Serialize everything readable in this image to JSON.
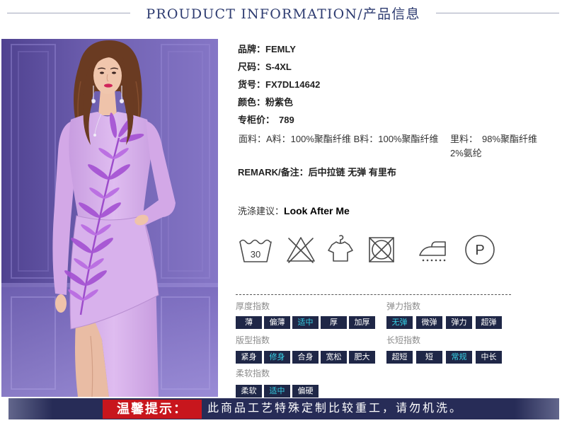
{
  "header": {
    "title": "PROUDUCT INFORMATION/产品信息"
  },
  "product": {
    "brand": {
      "label": "品牌：",
      "value": "FEMLY"
    },
    "size": {
      "label": "尺码：",
      "value": "S-4XL"
    },
    "item_no": {
      "label": "货号：",
      "value": "FX7DL14642"
    },
    "color": {
      "label": "颜色：",
      "value": "粉紫色"
    },
    "price": {
      "label": "专柜价：",
      "value": "789"
    },
    "fabric": {
      "label": "面料：",
      "parts": [
        "A料：100%聚酯纤维",
        "B料：100%聚酯纤维"
      ]
    },
    "lining": {
      "label": "里料：",
      "parts": [
        "98%聚酯纤维",
        "2%氨纶"
      ]
    },
    "remark": {
      "label": "REMARK/备注：",
      "value": "后中拉链 无弹 有里布"
    },
    "care": {
      "label": "洗涤建议：",
      "value": "Look After Me"
    }
  },
  "care_icons": [
    {
      "icon": "wash-30-icon",
      "text": "30"
    },
    {
      "icon": "no-bleach-icon"
    },
    {
      "icon": "hang-dry-icon"
    },
    {
      "icon": "no-tumble-dry-icon"
    },
    {
      "icon": "steam-iron-icon"
    },
    {
      "icon": "dry-clean-p-icon",
      "text": "P"
    }
  ],
  "indices": {
    "thickness": {
      "label": "厚度指数",
      "options": [
        "薄",
        "偏薄",
        "适中",
        "厚",
        "加厚"
      ],
      "selected": 2
    },
    "elasticity": {
      "label": "弹力指数",
      "options": [
        "无弹",
        "微弹",
        "弹力",
        "超弹"
      ],
      "selected": 0
    },
    "fit": {
      "label": "版型指数",
      "options": [
        "紧身",
        "修身",
        "合身",
        "宽松",
        "肥大"
      ],
      "selected": 1
    },
    "length": {
      "label": "长短指数",
      "options": [
        "超短",
        "短",
        "常规",
        "中长"
      ],
      "selected": 2
    },
    "softness": {
      "label": "柔软指数",
      "options": [
        "柔软",
        "适中",
        "偏硬"
      ],
      "selected": 1
    }
  },
  "notice": {
    "label": "温馨提示：",
    "text": "此商品工艺特殊定制比较重工，请勿机洗。"
  },
  "colors": {
    "header_text": "#2d3b70",
    "index_button_bg": "#1f2747",
    "selected_text": "#36cfe4",
    "notice_label_bg": "#c8161d",
    "banner_bg": "#272c57",
    "dress": "#d9b3ec"
  }
}
